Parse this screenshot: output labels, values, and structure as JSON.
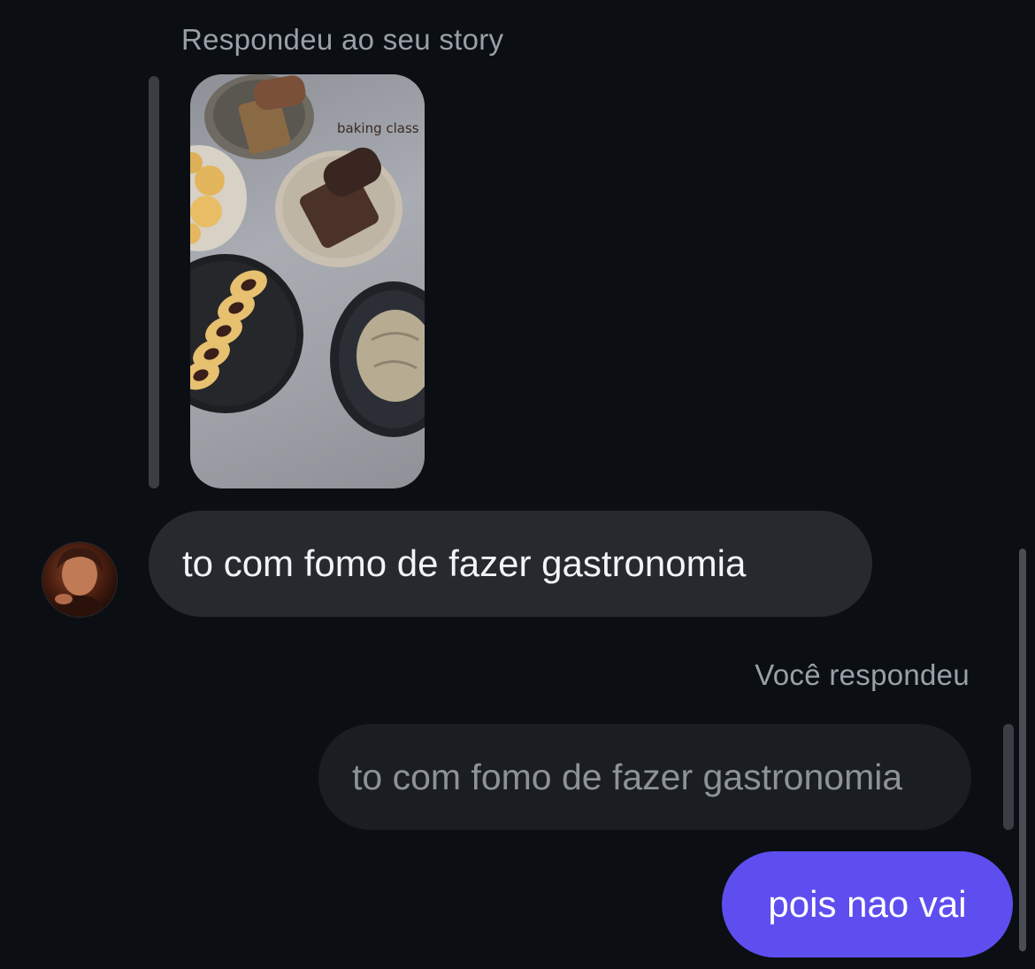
{
  "conversation": {
    "story_reply_label": "Respondeu ao seu story",
    "story_caption": "baking class",
    "incoming_message": "to com fomo de fazer gastronomia",
    "you_replied_label": "Você respondeu",
    "quoted_message": "to com fomo de fazer gastronomia",
    "outgoing_message": "pois nao vai"
  },
  "colors": {
    "background": "#0b0f14",
    "incoming_bubble": "#26292e",
    "outgoing_bubble": "#5e4ef0",
    "label_text": "#9aa0a8"
  }
}
